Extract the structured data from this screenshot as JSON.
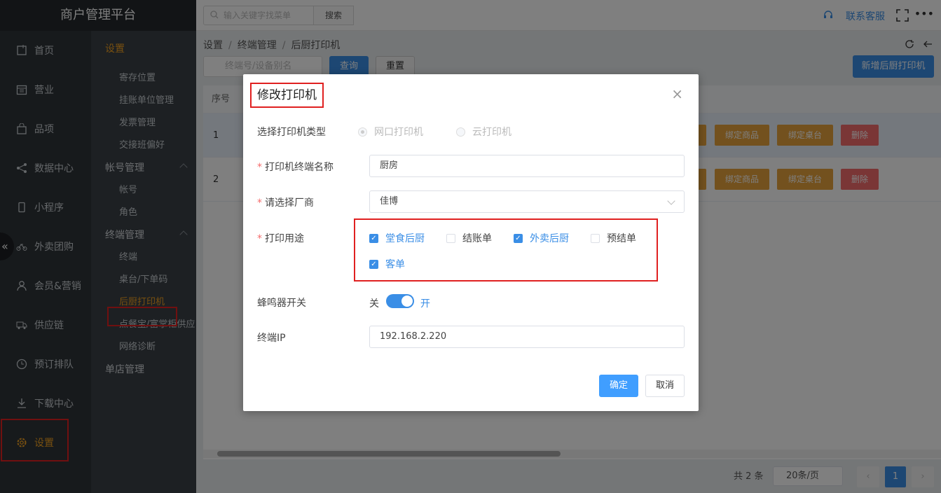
{
  "app": {
    "title": "商户管理平台"
  },
  "topbar": {
    "search_placeholder": "输入关键字找菜单",
    "search_button": "搜索",
    "service_label": "联系客服"
  },
  "nav": {
    "items": [
      {
        "label": "首页",
        "icon": "home-icon"
      },
      {
        "label": "营业",
        "icon": "calendar-icon"
      },
      {
        "label": "品项",
        "icon": "bag-icon"
      },
      {
        "label": "数据中心",
        "icon": "share-icon"
      },
      {
        "label": "小程序",
        "icon": "phone-icon"
      },
      {
        "label": "外卖团购",
        "icon": "bike-icon"
      },
      {
        "label": "会员&营销",
        "icon": "user-icon"
      },
      {
        "label": "供应链",
        "icon": "truck-icon"
      },
      {
        "label": "预订排队",
        "icon": "clock-icon"
      },
      {
        "label": "下载中心",
        "icon": "download-icon"
      },
      {
        "label": "设置",
        "icon": "gear-icon"
      }
    ]
  },
  "subnav": {
    "title": "设置",
    "group1": [
      "寄存位置",
      "挂账单位管理",
      "发票管理",
      "交接班偏好"
    ],
    "account_title": "帐号管理",
    "account_items": [
      "帐号",
      "角色"
    ],
    "terminal_title": "终端管理",
    "terminal_items": [
      "终端",
      "桌台/下单码",
      "后厨打印机",
      "点餐宝/富掌柜供应",
      "网络诊断"
    ],
    "store_title": "单店管理"
  },
  "breadcrumb": [
    "设置",
    "终端管理",
    "后厨打印机"
  ],
  "filter": {
    "placeholder": "终端号/设备别名",
    "query": "查询",
    "reset": "重置",
    "new_printer": "新增后厨打印机"
  },
  "table": {
    "header": "序号",
    "rows": [
      {
        "index": "1"
      },
      {
        "index": "2"
      }
    ],
    "actions": {
      "bind_goods": "绑定商品",
      "bind_table": "绑定桌台",
      "delete": "删除"
    }
  },
  "pager": {
    "total": "共 2 条",
    "per_page": "20条/页",
    "current": "1"
  },
  "modal": {
    "title": "修改打印机",
    "type_label": "选择打印机类型",
    "type_options": [
      "网口打印机",
      "云打印机"
    ],
    "name_label": "打印机终端名称",
    "name_value": "厨房",
    "vendor_label": "请选择厂商",
    "vendor_value": "佳博",
    "purpose_label": "打印用途",
    "purposes": [
      {
        "label": "堂食后厨",
        "checked": true
      },
      {
        "label": "结账单",
        "checked": false
      },
      {
        "label": "外卖后厨",
        "checked": true
      },
      {
        "label": "预结单",
        "checked": false
      },
      {
        "label": "客单",
        "checked": true
      }
    ],
    "buzzer_label": "蜂鸣器开关",
    "buzzer_off": "关",
    "buzzer_on": "开",
    "ip_label": "终端IP",
    "ip_value": "192.168.2.220",
    "confirm": "确定",
    "cancel": "取消"
  },
  "colors": {
    "accent": "#3a8ee6",
    "highlight": "#e02020",
    "warning": "#e6a23c",
    "danger": "#f56c6c",
    "active_menu": "#f0a020"
  }
}
